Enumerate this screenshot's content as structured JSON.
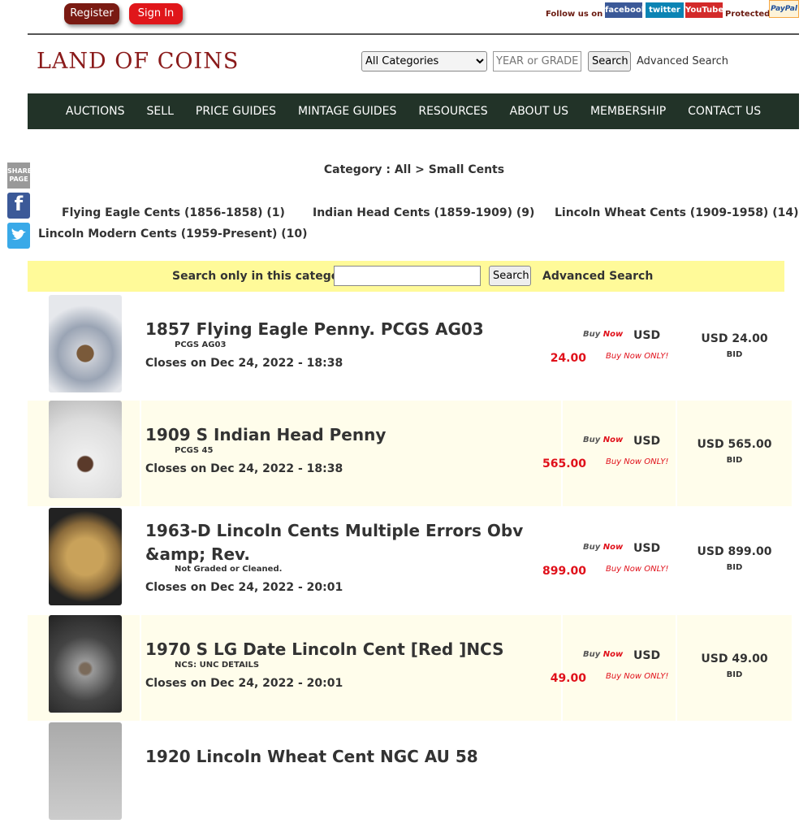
{
  "topbar": {
    "register": "Register",
    "signin": "Sign In",
    "follow": "Follow us on",
    "facebook": "facebook",
    "twitter": "twitter",
    "youtube": "YouTube",
    "protected": "Protected",
    "paypal": "PayPal"
  },
  "header": {
    "logo": "LAND OF COINS",
    "category_select": "All Categories",
    "year_placeholder": "YEAR or GRADE",
    "search": "Search",
    "advanced": "Advanced Search"
  },
  "nav": [
    "AUCTIONS",
    "SELL",
    "PRICE GUIDES",
    "MINTAGE GUIDES",
    "RESOURCES",
    "ABOUT US",
    "MEMBERSHIP",
    "CONTACT US"
  ],
  "share": {
    "label": "SHARE PAGE"
  },
  "breadcrumb": "Category : All > Small Cents",
  "subcategories": [
    "Flying Eagle Cents (1856-1858) (1)",
    "Indian Head Cents (1859-1909) (9)",
    "Lincoln Wheat Cents (1909-1958) (14)",
    "Lincoln Modern Cents (1959-Present) (10)"
  ],
  "catsearch": {
    "label": "Search only in this category",
    "value": "",
    "button": "Search",
    "advanced": "Advanced Search"
  },
  "listing_labels": {
    "buy": "Buy",
    "now": "Now",
    "usd": "USD",
    "only": "Buy Now ONLY!",
    "bid": "BID"
  },
  "listings": [
    {
      "title": "1857 Flying Eagle Penny. PCGS AG03",
      "grade": "PCGS AG03",
      "closes": "Closes on Dec 24, 2022 - 18:38",
      "price": "24.00",
      "bid": "USD 24.00"
    },
    {
      "title": "1909 S Indian Head Penny",
      "grade": "PCGS 45",
      "closes": "Closes on Dec 24, 2022 - 18:38",
      "price": "565.00",
      "bid": "USD 565.00"
    },
    {
      "title": "1963-D Lincoln Cents Multiple Errors Obv &amp; Rev.",
      "grade": "Not Graded or Cleaned.",
      "closes": "Closes on Dec 24, 2022 - 20:01",
      "price": "899.00",
      "bid": "USD 899.00"
    },
    {
      "title": "1970 S LG Date Lincoln Cent [Red ]NCS",
      "grade": "NCS: UNC DETAILS",
      "closes": "Closes on Dec 24, 2022 - 20:01",
      "price": "49.00",
      "bid": "USD 49.00"
    },
    {
      "title": "1920 Lincoln Wheat Cent NGC AU 58"
    }
  ]
}
